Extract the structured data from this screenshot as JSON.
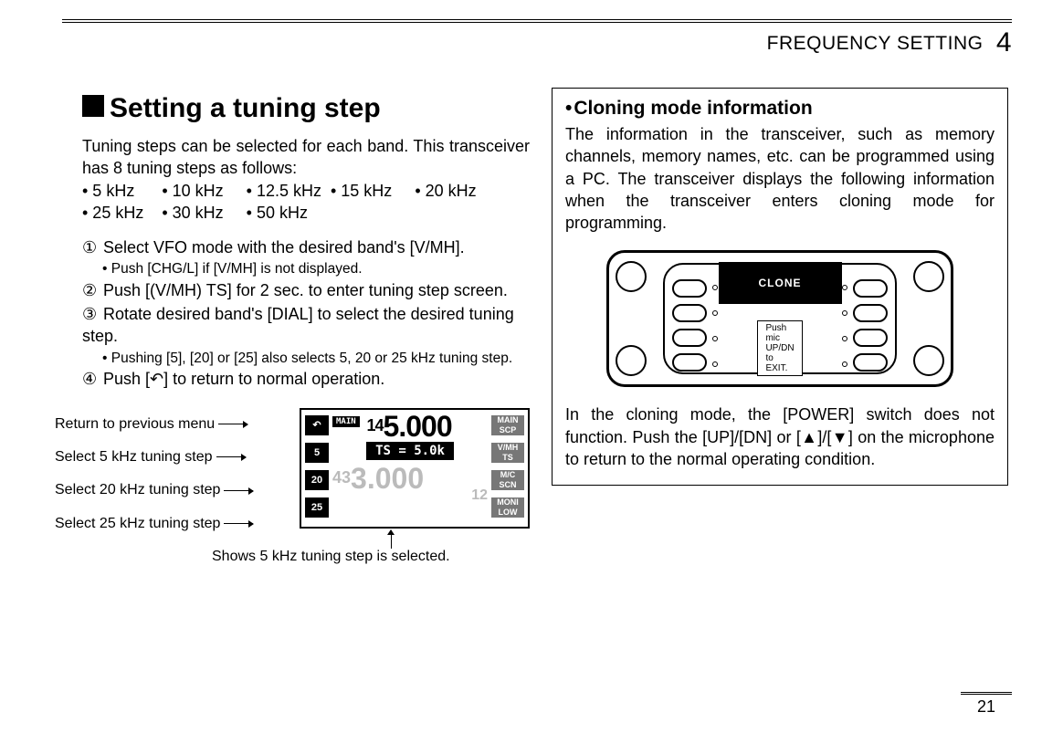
{
  "header": {
    "section": "FREQUENCY SETTING",
    "chapter": "4"
  },
  "left": {
    "title": "Setting a tuning step",
    "intro1": "Tuning steps can be selected for each band. This transceiver has 8 tuning steps as follows:",
    "tsteps_row1": "• 5 kHz      • 10 kHz     • 12.5 kHz  • 15 kHz     • 20 kHz",
    "tsteps_row2": "• 25 kHz    • 30 kHz     • 50 kHz",
    "steps": [
      {
        "num": "①",
        "text": "Select VFO mode with the desired band's [V/MH].",
        "note": "• Push [CHG/L] if [V/MH] is not displayed."
      },
      {
        "num": "②",
        "text": "Push [(V/MH) TS] for 2 sec. to enter tuning step screen.",
        "note": ""
      },
      {
        "num": "③",
        "text": "Rotate desired band's [DIAL] to select the desired tuning step.",
        "note": "• Pushing [5], [20] or [25] also selects 5, 20 or 25 kHz tuning step."
      },
      {
        "num": "④",
        "text": "Push [↶] to return to normal operation.",
        "note": ""
      }
    ],
    "diagram_labels": {
      "l1": "Return to previous menu",
      "l2": "Select 5 kHz tuning step",
      "l3": "Select 20 kHz tuning step",
      "l4": "Select 25 kHz tuning step",
      "caption": "Shows 5 kHz tuning step is selected."
    },
    "lcd": {
      "left_buttons": [
        "↶",
        "5",
        "20",
        "25"
      ],
      "right_buttons": [
        {
          "top": "MAIN",
          "bot": "SCP"
        },
        {
          "top": "V/MH",
          "bot": "TS"
        },
        {
          "top": "M/C",
          "bot": "SCN"
        },
        {
          "top": "MONI",
          "bot": "LOW"
        }
      ],
      "main_badge": "MAIN",
      "freq1_small": "14",
      "freq1_big": "5.000",
      "ts_label": "TS = 5.0k",
      "freq2_small": "43",
      "freq2_big": "3.000",
      "sub": "12"
    }
  },
  "right": {
    "title": "Cloning mode information",
    "para1": "The information in the transceiver, such as memory channels, memory names, etc. can be programmed using a PC. The transceiver displays the following information when the transceiver enters cloning mode for programming.",
    "clone_label": "CLONE",
    "mic_label": "Push mic UP/DN to EXIT.",
    "para2": "In the cloning mode, the [POWER] switch does not function. Push the [UP]/[DN] or [▲]/[▼] on the microphone to return to the normal operating condition."
  },
  "page_number": "21"
}
